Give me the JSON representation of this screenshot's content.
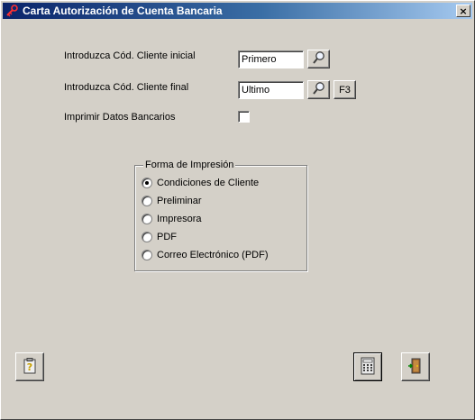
{
  "window": {
    "title": "Carta Autorización de Cuenta Bancaria",
    "icon": "app-key-icon",
    "close_label": "×"
  },
  "form": {
    "cliente_inicial": {
      "label": "Introduzca Cód. Cliente inicial",
      "value": "Primero",
      "lookup_icon": "magnifier-icon"
    },
    "cliente_final": {
      "label": "Introduzca Cód. Cliente final",
      "value": "Ultimo",
      "lookup_icon": "magnifier-icon",
      "f3_label": "F3"
    },
    "imprimir_datos": {
      "label": "Imprimir Datos Bancarios",
      "checked": false
    }
  },
  "forma_impresion": {
    "legend": "Forma de Impresión",
    "options": [
      {
        "label": "Condiciones de Cliente",
        "selected": true
      },
      {
        "label": "Preliminar",
        "selected": false
      },
      {
        "label": "Impresora",
        "selected": false
      },
      {
        "label": "PDF",
        "selected": false
      },
      {
        "label": "Correo Electrónico (PDF)",
        "selected": false
      }
    ]
  },
  "footer": {
    "help_icon": "help-clipboard-icon",
    "calculator_icon": "calculator-icon",
    "exit_icon": "exit-door-icon"
  }
}
